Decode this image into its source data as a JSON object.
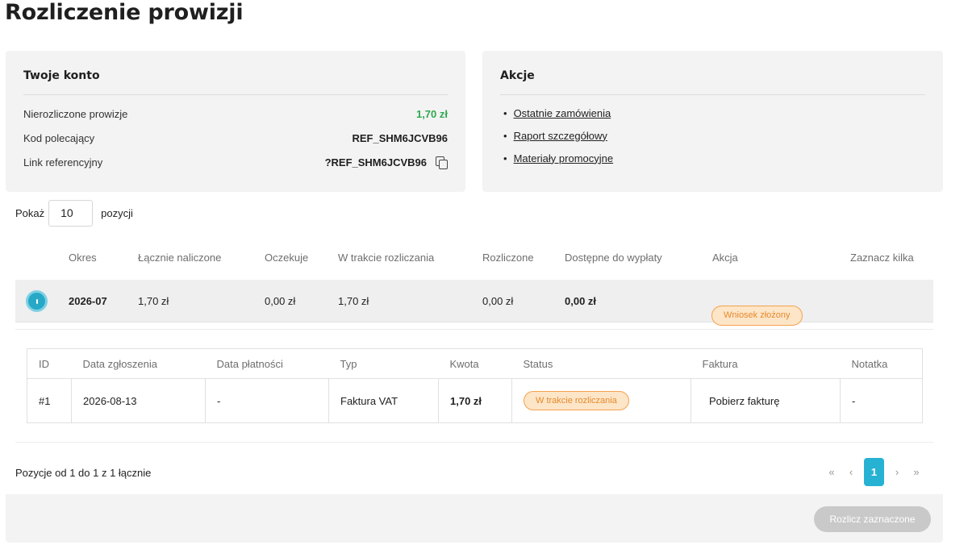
{
  "page": {
    "title": "Rozliczenie prowizji"
  },
  "account": {
    "title": "Twoje konto",
    "rows": [
      {
        "label": "Nierozliczone prowizje",
        "value": "1,70 zł"
      },
      {
        "label": "Kod polecający",
        "value": "REF_SHM6JCVB96"
      },
      {
        "label": "Link referencyjny",
        "value": "?REF_SHM6JCVB96"
      }
    ],
    "copy_icon": "copy-icon",
    "accent_color": "#2fa84f"
  },
  "actions": {
    "title": "Akcje",
    "links": [
      "Ostatnie zamówienia",
      "Raport szczegółowy",
      "Materiały promocyjne"
    ]
  },
  "show": {
    "prefix": "Pokaż",
    "value": "10",
    "suffix": "pozycji"
  },
  "table": {
    "headers": [
      "Okres",
      "Łącznie naliczone",
      "Oczekuje",
      "W trakcie rozliczania",
      "Rozliczone",
      "Dostępne do wypłaty",
      "Akcja",
      "Zaznacz kilka"
    ],
    "row": {
      "period": "2026-07",
      "total": "1,70 zł",
      "pending": "0,00 zł",
      "in_progress": "1,70 zł",
      "settled": "0,00 zł",
      "available": "0,00 zł",
      "action_badge": "Wniosek złożony"
    }
  },
  "subtable": {
    "headers": [
      "ID",
      "Data zgłoszenia",
      "Data płatności",
      "Typ",
      "Kwota",
      "Status",
      "Faktura",
      "Notatka"
    ],
    "row": {
      "id": "#1",
      "submitted": "2026-08-13",
      "paid": "-",
      "type": "Faktura VAT",
      "amount": "1,70 zł",
      "status": "W trakcie rozliczania",
      "invoice": "Pobierz fakturę",
      "note": "-"
    }
  },
  "pagination": {
    "info": "Pozycje od 1 do 1 z 1 łącznie",
    "first": "«",
    "prev": "‹",
    "current": "1",
    "next": "›",
    "last": "»",
    "active_color": "#27b2d4"
  },
  "bottom": {
    "settle_label": "Rozlicz zaznaczone"
  }
}
